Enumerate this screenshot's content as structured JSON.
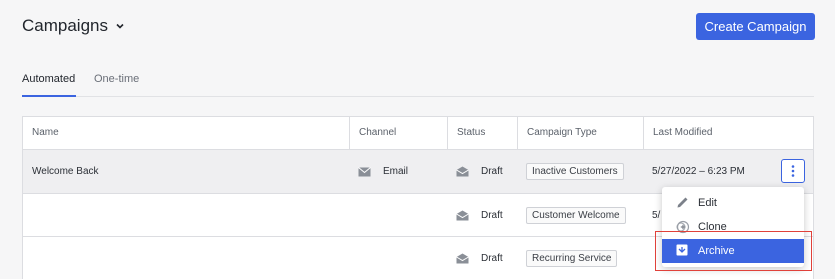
{
  "header": {
    "title": "Campaigns",
    "create_label": "Create Campaign"
  },
  "tabs": [
    {
      "label": "Automated",
      "active": true
    },
    {
      "label": "One-time",
      "active": false
    }
  ],
  "table": {
    "columns": [
      "Name",
      "Channel",
      "Status",
      "Campaign Type",
      "Last Modified"
    ],
    "rows": [
      {
        "name": "Welcome Back",
        "channel": "Email",
        "status": "Draft",
        "type": "Inactive Customers",
        "modified": "5/27/2022 – 6:23 PM",
        "highlighted": true
      },
      {
        "name": "",
        "channel": "",
        "status": "Draft",
        "type": "Customer Welcome",
        "modified": "5/",
        "highlighted": false
      },
      {
        "name": "",
        "channel": "",
        "status": "Draft",
        "type": "Recurring Service",
        "modified": "",
        "highlighted": false
      }
    ]
  },
  "menu": {
    "items": [
      {
        "label": "Edit",
        "icon": "pencil-icon"
      },
      {
        "label": "Clone",
        "icon": "clone-icon"
      },
      {
        "label": "Archive",
        "icon": "archive-icon",
        "selected": true
      }
    ]
  },
  "colors": {
    "accent": "#3b64e0",
    "highlight_box": "#e0413a"
  }
}
